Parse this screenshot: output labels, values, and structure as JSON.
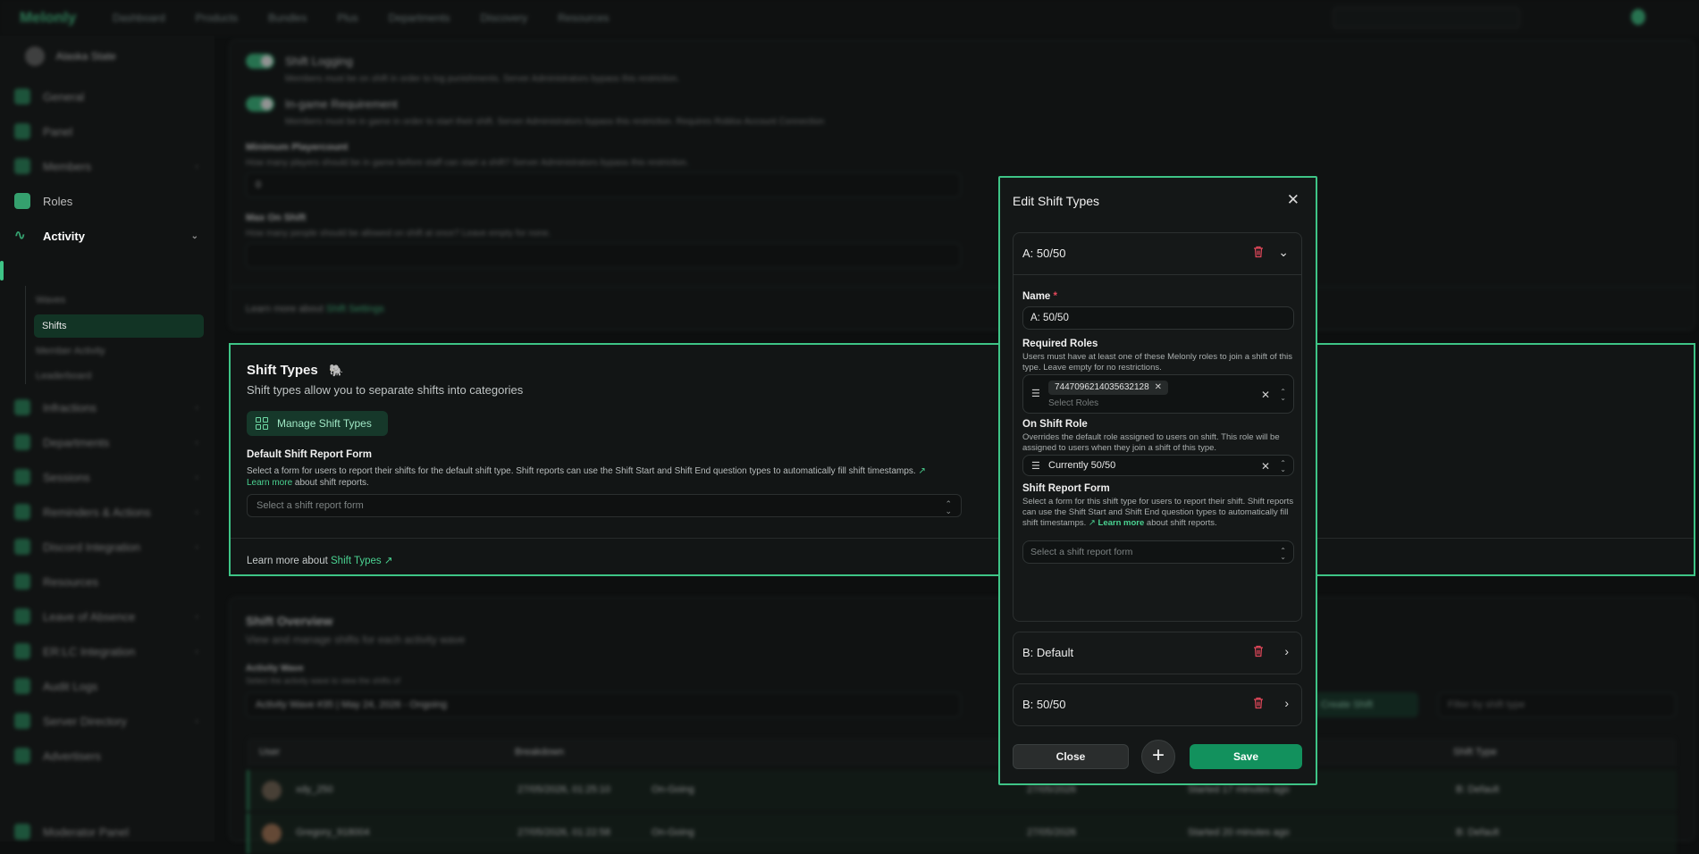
{
  "app": {
    "brand": "Melonly"
  },
  "topnav": {
    "items": [
      "Dashboard",
      "Products",
      "Bundles",
      "Plus",
      "Departments",
      "Discovery",
      "Resources"
    ]
  },
  "sidebar": {
    "server_name": "Alaska State",
    "items": [
      {
        "label": "General"
      },
      {
        "label": "Panel"
      },
      {
        "label": "Members"
      },
      {
        "label": "Roles"
      },
      {
        "label": "Activity"
      },
      {
        "label": "Infractions"
      },
      {
        "label": "Departments"
      },
      {
        "label": "Sessions"
      },
      {
        "label": "Reminders & Actions"
      },
      {
        "label": "Discord Integration"
      },
      {
        "label": "Resources"
      },
      {
        "label": "Leave of Absence"
      },
      {
        "label": "ER:LC Integration"
      },
      {
        "label": "Audit Logs"
      },
      {
        "label": "Server Directory"
      },
      {
        "label": "Advertisers"
      }
    ],
    "activity_sub": [
      "Waves",
      "Shifts",
      "Member Activity",
      "Leaderboard"
    ],
    "footer": "Moderator Panel"
  },
  "settings": {
    "shift_logging": {
      "title": "Shift Logging",
      "desc": "Members must be on shift in order to log punishments. Server Administrators bypass this restriction."
    },
    "ingame_req": {
      "title": "In-game Requirement",
      "desc": "Members must be in game in order to start their shift. Server Administrators bypass this restriction. Requires Roblox Account Connection"
    },
    "min_player": {
      "title": "Minimum Playercount",
      "desc": "How many players should be in game before staff can start a shift? Server Administrators bypass this restriction.",
      "value": "0"
    },
    "max_on_shift": {
      "title": "Max On Shift",
      "desc": "How many people should be allowed on shift at once? Leave empty for none.",
      "value": ""
    },
    "learn_more_prefix": "Learn more about",
    "learn_more_link": "Shift Settings"
  },
  "shift_types": {
    "title": "Shift Types",
    "subtitle": "Shift types allow you to separate shifts into categories",
    "manage_button": "Manage Shift Types",
    "default_form_label": "Default Shift Report Form",
    "default_form_desc": "Select a form for users to report their shifts for the default shift type. Shift reports can use the Shift Start and Shift End question types to automatically fill shift timestamps.",
    "learn_more": "Learn more",
    "learn_more_suffix": "about shift reports.",
    "select_placeholder": "Select a shift report form",
    "footer_prefix": "Learn more about",
    "footer_link": "Shift Types"
  },
  "overview": {
    "title": "Shift Overview",
    "subtitle": "View and manage shifts for each activity wave",
    "wave_label": "Activity Wave",
    "wave_desc": "Select the activity wave to view the shifts of",
    "wave_value": "Activity Wave #35 | May 24, 2026 - Ongoing",
    "create_button": "Create Shift",
    "filter_placeholder": "Filter by shift type",
    "columns": [
      "User",
      "Breakdown",
      "",
      "",
      "Shift Type"
    ],
    "rows": [
      {
        "user": "xdy_250",
        "start": "27/05/2026, 01:25:10",
        "status": "On-Going",
        "date": "27/05/2026",
        "started": "Started 17 minutes ago",
        "type": "B: Default"
      },
      {
        "user": "Gregory_918004",
        "start": "27/05/2026, 01:22:58",
        "status": "On-Going",
        "date": "27/05/2026",
        "started": "Started 20 minutes ago",
        "type": "B: Default"
      }
    ]
  },
  "modal": {
    "title": "Edit Shift Types",
    "expanded": {
      "header": "A: 50/50",
      "name_label": "Name",
      "name_required": "*",
      "name_value": "A: 50/50",
      "roles_label": "Required Roles",
      "roles_desc": "Users must have at least one of these Melonly roles to join a shift of this type. Leave empty for no restrictions.",
      "role_chip": "744709621403563212​8",
      "roles_placeholder": "Select Roles",
      "onshift_label": "On Shift Role",
      "onshift_desc": "Overrides the default role assigned to users on shift. This role will be assigned to users when they join a shift of this type.",
      "onshift_value": "Currently 50/50",
      "report_label": "Shift Report Form",
      "report_desc_a": "Select a form for this shift type for users to report their shift. Shift reports can use the Shift Start and Shift End question types to automatically fill shift timestamps.",
      "report_learn": "Learn more",
      "report_desc_b": "about shift reports.",
      "report_placeholder": "Select a shift report form"
    },
    "collapsed": [
      {
        "label": "B: Default"
      },
      {
        "label": "B: 50/50"
      }
    ],
    "close_button": "Close",
    "add_button": "+",
    "save_button": "Save"
  },
  "colors": {
    "accent": "#3ec486",
    "danger": "#e3485a",
    "save": "#12915d"
  }
}
